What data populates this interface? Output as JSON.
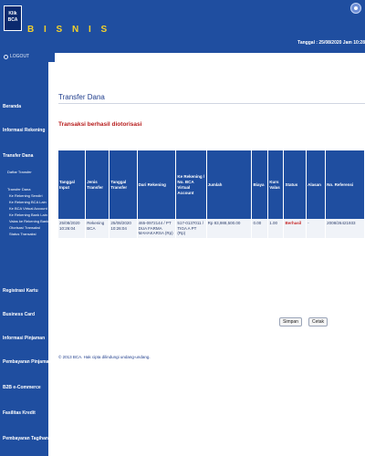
{
  "header": {
    "logo_text": "Klik BCA",
    "brand": "B I S N I S",
    "date_line": "Tanggal : 25/08/2020 Jam 10:28"
  },
  "logout": {
    "label": "LOGOUT"
  },
  "sidebar": {
    "items": [
      {
        "label": "Beranda"
      },
      {
        "label": "Informasi Rekening"
      },
      {
        "label": "Transfer Dana"
      },
      {
        "label": "Registrasi Kartu"
      },
      {
        "label": "Business Card"
      },
      {
        "label": "Informasi Pinjaman"
      },
      {
        "label": "Pembayaran Pinjaman"
      },
      {
        "label": "B2B e-Commerce"
      },
      {
        "label": "Fasilitas Kredit"
      },
      {
        "label": "Pembayaran Tagihan"
      }
    ],
    "subitems": [
      {
        "label": "Daftar Transfer"
      },
      {
        "label": "Transfer Dana"
      },
      {
        "label": "Ke Rekening Sendiri"
      },
      {
        "label": "Ke Rekening BCA Lain"
      },
      {
        "label": "Ke BCA Virtual Account"
      },
      {
        "label": "Ke Rekening Bank Lain"
      },
      {
        "label": "Valas ke Rekening Bank"
      },
      {
        "label": "Otorisasi Transaksi"
      },
      {
        "label": "Status Transaksi"
      }
    ]
  },
  "main": {
    "title": "Transfer Dana",
    "message": "Transaksi berhasil diotorisasi",
    "table": {
      "headers": [
        "Tanggal Input",
        "Jenis Transfer",
        "Tanggal Transfer",
        "Dari Rekening",
        "Ke Rekening / No. BCA Virtual Account",
        "Jumlah",
        "Biaya",
        "Kurs Valas",
        "Status",
        "Alasan",
        "No. Referensi"
      ],
      "rows": [
        [
          "25/08/2020 10:26:04",
          "Rekening BCA",
          "25/08/2020 10:26:04",
          "465-0972144 / PT DUA FARMA MAHAKARSA (Rp)",
          "517-0137011 / TIGA A PT (Rp)",
          "Rp 83,988,500.00",
          "0.00",
          "1.00",
          "Berhasil",
          "-",
          "2008/26421933"
        ]
      ]
    },
    "buttons": {
      "save": "Simpan",
      "print": "Cetak"
    },
    "copyright": "© 2013 BCA. Hak cipta dilindungi undang-undang."
  }
}
